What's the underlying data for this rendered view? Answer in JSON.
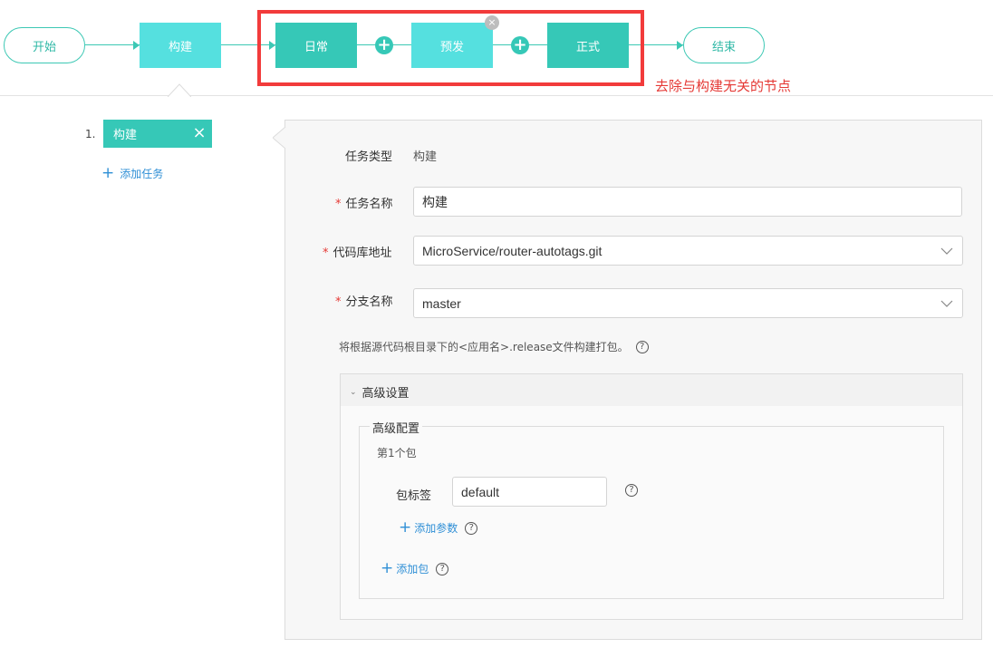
{
  "pipeline": {
    "start_label": "开始",
    "build_label": "构建",
    "stages": [
      {
        "label": "日常"
      },
      {
        "label": "预发"
      },
      {
        "label": "正式"
      }
    ],
    "end_label": "结束",
    "annotation": "去除与构建无关的节点",
    "colors": {
      "accent": "#36c8b7",
      "light_node": "#55e0df",
      "highlight": "#f23b3b"
    }
  },
  "tasks": {
    "items": [
      {
        "index": "1.",
        "label": "构建"
      }
    ],
    "add_label": "添加任务"
  },
  "form": {
    "task_type_label": "任务类型",
    "task_type_value": "构建",
    "task_name_label": "任务名称",
    "task_name_value": "构建",
    "repo_label": "代码库地址",
    "repo_value": "MicroService/router-autotags.git",
    "branch_label": "分支名称",
    "branch_value": "master",
    "required_mark": "*",
    "hint": "将根据源代码根目录下的<应用名>.release文件构建打包。"
  },
  "advanced": {
    "title": "高级设置",
    "config_title": "高级配置",
    "package_index": "第1个包",
    "package_tag_label": "包标签",
    "package_tag_value": "default",
    "add_param_label": "添加参数",
    "add_package_label": "添加包"
  },
  "icons": {
    "help": "?",
    "plus": "+",
    "close": "×"
  }
}
